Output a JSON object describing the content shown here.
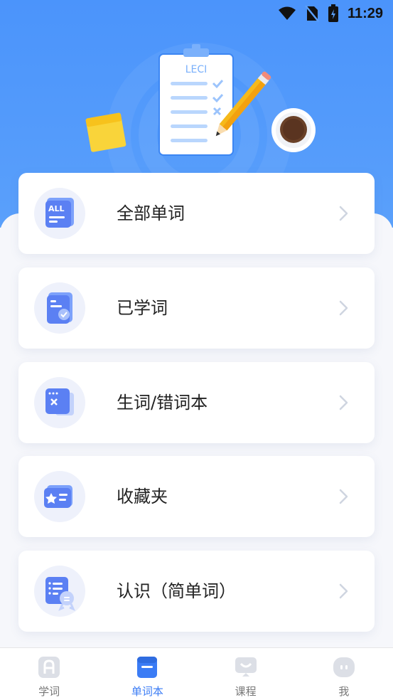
{
  "status_bar": {
    "time": "11:29"
  },
  "header": {
    "clipboard_text": "LECI"
  },
  "menu": [
    {
      "label": "全部单词",
      "icon": "all-words-icon"
    },
    {
      "label": "已学词",
      "icon": "learned-words-icon"
    },
    {
      "label": "生词/错词本",
      "icon": "wrong-words-icon"
    },
    {
      "label": "收藏夹",
      "icon": "favorites-icon"
    },
    {
      "label": "认识（简单词）",
      "icon": "easy-words-icon"
    }
  ],
  "tabs": [
    {
      "label": "学词",
      "icon": "learn-icon",
      "active": false
    },
    {
      "label": "单词本",
      "icon": "wordbook-icon",
      "active": true
    },
    {
      "label": "课程",
      "icon": "course-icon",
      "active": false
    },
    {
      "label": "我",
      "icon": "profile-icon",
      "active": false
    }
  ],
  "colors": {
    "primary": "#4b94fb",
    "active_tab": "#3b7cf5",
    "tab_inactive": "#777777"
  }
}
